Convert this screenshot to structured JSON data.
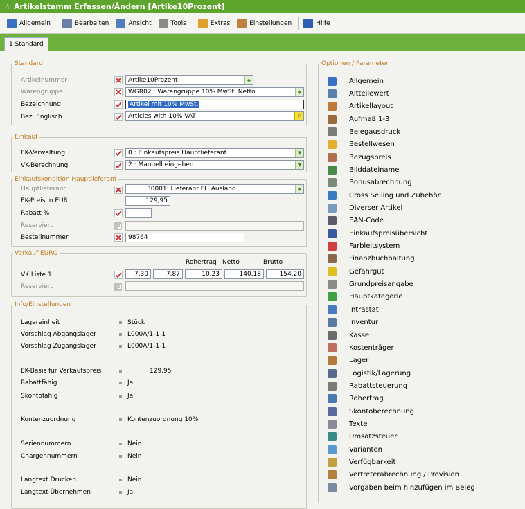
{
  "title": "Artikelstamm Erfassen/Ändern [Artike10Prozent]",
  "menu": [
    {
      "label": "Allgemein",
      "icon": "pin-icon",
      "color": "#3a6fc4"
    },
    {
      "label": "Bearbeiten",
      "icon": "edit-icon",
      "color": "#6a7fa8"
    },
    {
      "label": "Ansicht",
      "icon": "view-icon",
      "color": "#4f7fbf"
    },
    {
      "label": "Tools",
      "icon": "tools-icon",
      "color": "#8a8a8a"
    },
    {
      "label": "Extras",
      "icon": "extras-icon",
      "color": "#e0a030"
    },
    {
      "label": "Einstellungen",
      "icon": "settings-icon",
      "color": "#c08040"
    },
    {
      "label": "Hilfe",
      "icon": "help-icon",
      "color": "#2f5fb3"
    }
  ],
  "tab": "1 Standard",
  "standard": {
    "legend": "Standard",
    "artikelnummer_label": "Artikelnummer",
    "artikelnummer": "Artike10Prozent",
    "warengruppe_label": "Warengruppe",
    "warengruppe": "WGR02 : Warengruppe 10% MwSt. Netto",
    "bezeichnung_label": "Bezeichnung",
    "bezeichnung": "Artikel mit 10% MwSt.",
    "bez_englisch_label": "Bez. Englisch",
    "bez_englisch": "Articles with 10% VAT"
  },
  "einkauf": {
    "legend": "Einkauf",
    "ek_verwaltung_label": "EK-Verwaltung",
    "ek_verwaltung": "0 : Einkaufspreis Hauptlieferant",
    "vk_berechnung_label": "VK-Berechnung",
    "vk_berechnung": "2 : Manuell eingeben"
  },
  "kondition": {
    "legend": "Einkaufskondition Hauptlieferant",
    "hauptlieferant_label": "Hauptlieferant",
    "hauptlieferant": "30001: Lieferant EU Ausland",
    "ek_preis_label": "EK-Preis in EUR",
    "ek_preis": "129,95",
    "rabatt_label": "Rabatt %",
    "rabatt": "",
    "reserviert_label": "Reserviert",
    "reserviert": "",
    "bestellnummer_label": "Bestellnummer",
    "bestellnummer": "98764"
  },
  "verkauf": {
    "legend": "Verkauf EURO",
    "col_rohertrag": "Rohertrag",
    "col_netto": "Netto",
    "col_brutto": "Brutto",
    "vk_liste_label": "VK Liste 1",
    "v1": "7,30",
    "v2": "7,87",
    "rohertrag": "10,23",
    "netto": "140,18",
    "brutto": "154,20",
    "reserviert_label": "Reserviert",
    "reserviert": ""
  },
  "info": {
    "legend": "Info/Einstellungen",
    "items": [
      {
        "label": "Lagereinheit",
        "value": "Stück"
      },
      {
        "label": "Vorschlag Abgangslager",
        "value": "L000A/1-1-1"
      },
      {
        "label": "Vorschlag Zugangslager",
        "value": "L000A/1-1-1"
      },
      {
        "label": "EK-Basis für Verkaufspreis",
        "value": "129,95"
      },
      {
        "label": "Rabattfähig",
        "value": "Ja"
      },
      {
        "label": "Skontofähig",
        "value": "Ja"
      },
      {
        "label": "Kontenzuordnung",
        "value": "Kontenzuordnung 10%"
      },
      {
        "label": "Seriennummern",
        "value": "Nein"
      },
      {
        "label": "Chargennummern",
        "value": "Nein"
      },
      {
        "label": "Langtext Drucken",
        "value": "Nein"
      },
      {
        "label": "Langtext Übernehmen",
        "value": "Ja"
      }
    ]
  },
  "options": {
    "legend": "Optionen / Parameter",
    "items": [
      {
        "label": "Allgemein",
        "color": "#3a6fc4"
      },
      {
        "label": "Altteilewert",
        "color": "#5a7fa8"
      },
      {
        "label": "Artikellayout",
        "color": "#c07a3a"
      },
      {
        "label": "Aufmaß 1-3",
        "color": "#9a6a3a"
      },
      {
        "label": "Belegausdruck",
        "color": "#7a7a7a"
      },
      {
        "label": "Bestellwesen",
        "color": "#e0b030"
      },
      {
        "label": "Bezugspreis",
        "color": "#b07050"
      },
      {
        "label": "Bilddateiname",
        "color": "#4a8a4a"
      },
      {
        "label": "Bonusabrechnung",
        "color": "#7a8a7a"
      },
      {
        "label": "Cross Selling und Zubehör",
        "color": "#3a7ac0"
      },
      {
        "label": "Diverser Artikel",
        "color": "#7a9ac0"
      },
      {
        "label": "EAN-Code",
        "color": "#5a5a6a"
      },
      {
        "label": "Einkaufspreisübersicht",
        "color": "#3a5aa0"
      },
      {
        "label": "Farbleitsystem",
        "color": "#d04040"
      },
      {
        "label": "Finanzbuchhaltung",
        "color": "#8a6a4a"
      },
      {
        "label": "Gefahrgut",
        "color": "#e0c020"
      },
      {
        "label": "Grundpreisangabe",
        "color": "#8a8a8a"
      },
      {
        "label": "Hauptkategorie",
        "color": "#40a040"
      },
      {
        "label": "Intrastat",
        "color": "#4a7ac0"
      },
      {
        "label": "Inventur",
        "color": "#5a7aa0"
      },
      {
        "label": "Kasse",
        "color": "#6a6a6a"
      },
      {
        "label": "Kostenträger",
        "color": "#c07060"
      },
      {
        "label": "Lager",
        "color": "#b07a3a"
      },
      {
        "label": "Logistik/Lagerung",
        "color": "#5a6a8a"
      },
      {
        "label": "Rabattsteuerung",
        "color": "#7a7a7a"
      },
      {
        "label": "Rohertrag",
        "color": "#4a7ab0"
      },
      {
        "label": "Skontoberechnung",
        "color": "#5a6a9a"
      },
      {
        "label": "Texte",
        "color": "#8a8a9a"
      },
      {
        "label": "Umsatzsteuer",
        "color": "#3a8a8a"
      },
      {
        "label": "Varianten",
        "color": "#5a9ad0"
      },
      {
        "label": "Verfügbarkeit",
        "color": "#c0a040"
      },
      {
        "label": "Vertreterabrechnung / Provision",
        "color": "#b08040"
      },
      {
        "label": "Vorgaben beim hinzufügen im Beleg",
        "color": "#7a8aa0"
      }
    ]
  }
}
